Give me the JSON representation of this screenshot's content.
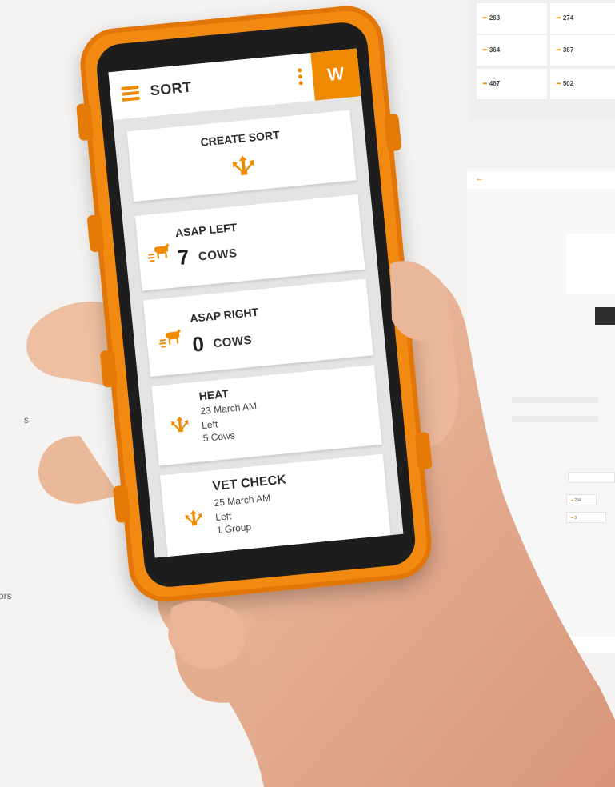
{
  "background": {
    "grid": [
      [
        "263",
        "274"
      ],
      [
        "364",
        "367"
      ],
      [
        "467",
        "502"
      ]
    ],
    "selects": [
      "234",
      "3"
    ],
    "left_fragments": [
      "s",
      "ors"
    ]
  },
  "app": {
    "header_title": "SORT",
    "brand_letter": "W",
    "create": {
      "title": "CREATE SORT"
    },
    "cards": [
      {
        "title": "ASAP LEFT",
        "count": "7",
        "unit": "COWS"
      },
      {
        "title": "ASAP RIGHT",
        "count": "0",
        "unit": "COWS"
      },
      {
        "title": "HEAT",
        "lines": [
          "23 March AM",
          "Left",
          "5 Cows"
        ]
      },
      {
        "title": "VET CHECK",
        "lines": [
          "25 March AM",
          "Left",
          "1 Group"
        ]
      }
    ]
  },
  "colors": {
    "accent": "#f08a00",
    "case": "#f28a12"
  }
}
